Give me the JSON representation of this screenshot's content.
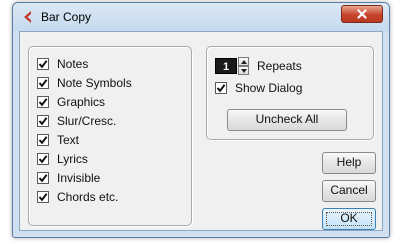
{
  "window": {
    "title": "Bar Copy",
    "close_label": "x"
  },
  "checkboxes": [
    {
      "label": "Notes",
      "checked": true
    },
    {
      "label": "Note Symbols",
      "checked": true
    },
    {
      "label": "Graphics",
      "checked": true
    },
    {
      "label": "Slur/Cresc.",
      "checked": true
    },
    {
      "label": "Text",
      "checked": true
    },
    {
      "label": "Lyrics",
      "checked": true
    },
    {
      "label": "Invisible",
      "checked": true
    },
    {
      "label": "Chords etc.",
      "checked": true
    }
  ],
  "repeats": {
    "value": "1",
    "label": "Repeats"
  },
  "show_dialog": {
    "label": "Show Dialog",
    "checked": true
  },
  "buttons": {
    "uncheck_all": "Uncheck All",
    "help": "Help",
    "cancel": "Cancel",
    "ok": "OK"
  },
  "icons": {
    "app": "cubase-logo-icon",
    "close": "close-icon",
    "check": "checkmark-icon",
    "spin_up": "spin-up-icon",
    "spin_down": "spin-down-icon"
  },
  "colors": {
    "app_icon": "#c0392b",
    "close_button": "#c7432a",
    "title_bar": "#cfe0f2",
    "dialog_bg": "#f0f0f0",
    "repeats_field_bg": "#1a1a1a",
    "ok_border": "#3c7fb1"
  }
}
